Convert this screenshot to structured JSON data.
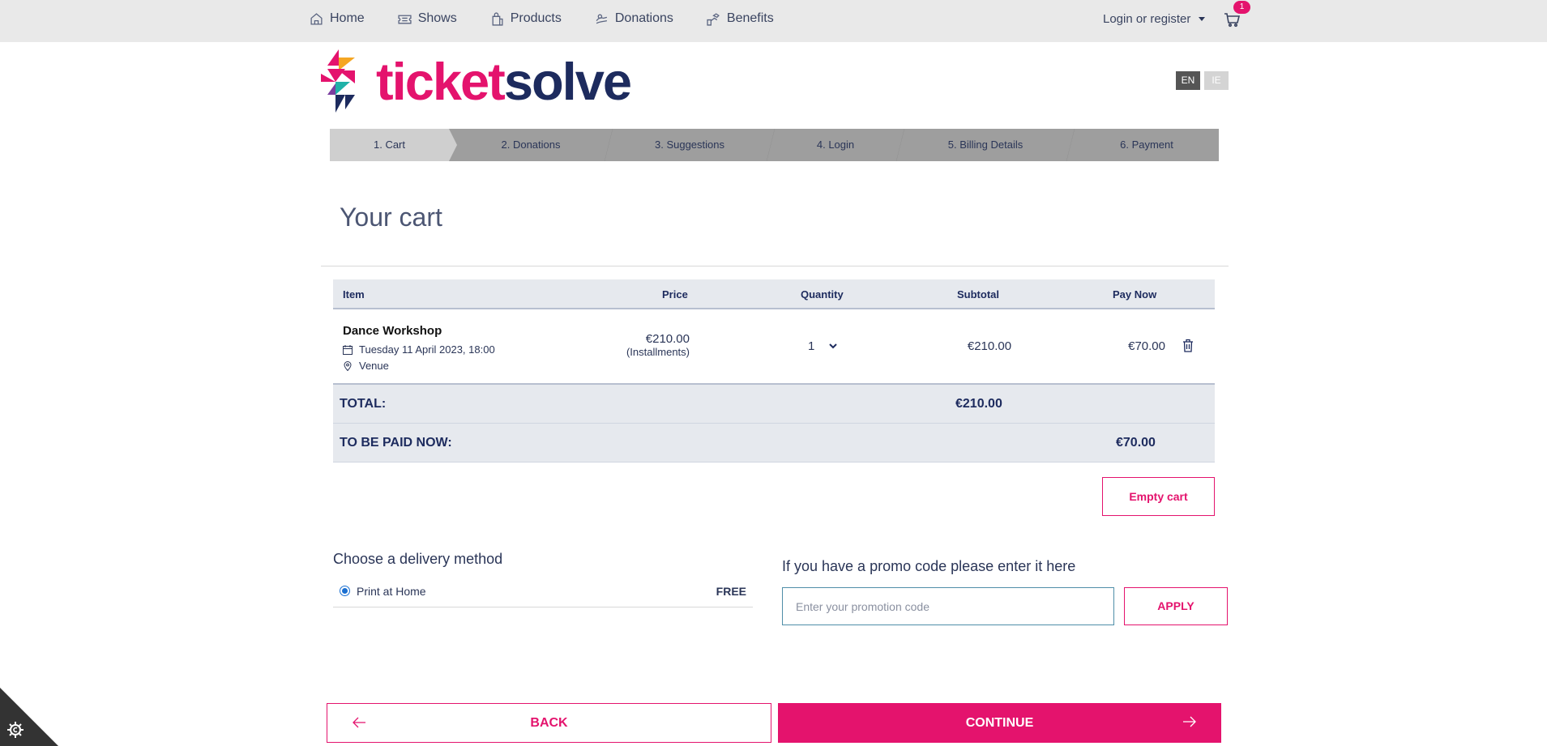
{
  "nav": {
    "items": [
      {
        "label": "Home",
        "icon": "home-icon"
      },
      {
        "label": "Shows",
        "icon": "ticket-icon"
      },
      {
        "label": "Products",
        "icon": "shopping-bag-icon"
      },
      {
        "label": "Donations",
        "icon": "donation-icon"
      },
      {
        "label": "Benefits",
        "icon": "benefits-icon"
      }
    ],
    "login": "Login or register",
    "cart_count": "1"
  },
  "brand": {
    "part1": "ticket",
    "part2": "solve",
    "pink": "#e4136d",
    "navy": "#1d2b5e"
  },
  "lang": {
    "en": "EN",
    "ie": "IE"
  },
  "steps": [
    "1. Cart",
    "2. Donations",
    "3. Suggestions",
    "4. Login",
    "5. Billing Details",
    "6. Payment"
  ],
  "page_title": "Your cart",
  "table": {
    "headers": {
      "item": "Item",
      "price": "Price",
      "quantity": "Quantity",
      "subtotal": "Subtotal",
      "pay_now": "Pay Now"
    },
    "row": {
      "name": "Dance Workshop",
      "date": "Tuesday 11 April 2023, 18:00",
      "venue": "Venue",
      "price": "€210.00",
      "price_note": "(Installments)",
      "quantity": "1",
      "subtotal": "€210.00",
      "pay_now": "€70.00"
    },
    "total_label": "TOTAL:",
    "total_value": "€210.00",
    "paid_now_label": "TO BE PAID NOW:",
    "paid_now_value": "€70.00"
  },
  "empty_cart": "Empty cart",
  "delivery": {
    "title": "Choose a delivery method",
    "option": "Print at Home",
    "price": "FREE"
  },
  "promo": {
    "title": "If you have a promo code please enter it here",
    "placeholder": "Enter your promotion code",
    "apply": "APPLY"
  },
  "buttons": {
    "back": "BACK",
    "continue": "CONTINUE"
  }
}
